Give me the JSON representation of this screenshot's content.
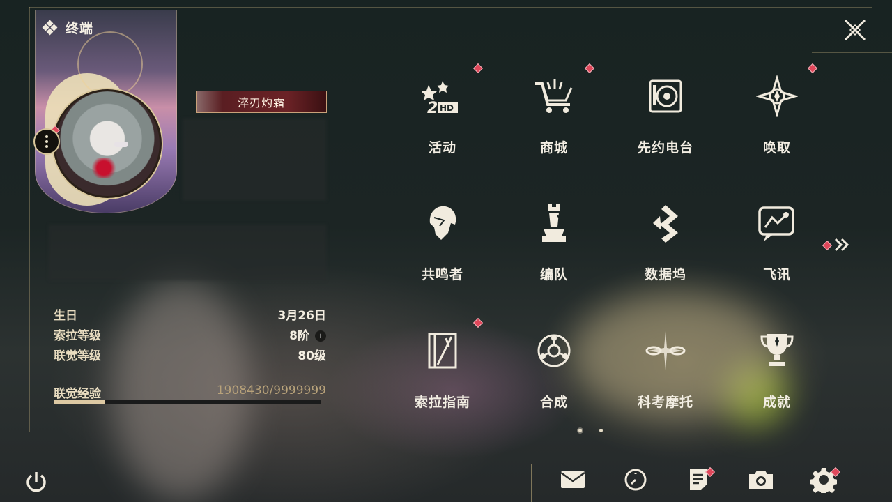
{
  "header": {
    "title": "终端"
  },
  "profile": {
    "name": "淬刃灼霜",
    "stats": [
      {
        "label": "生日",
        "value": "3月26日"
      },
      {
        "label": "索拉等级",
        "value": "8阶",
        "has_info": true
      },
      {
        "label": "联觉等级",
        "value": "80级"
      }
    ],
    "experience": {
      "label": "联觉经验",
      "value": "1908430/9999999",
      "progress": 0.19
    }
  },
  "menu": {
    "items": [
      {
        "label": "活动",
        "icon": "event-2hd-icon",
        "badge": true
      },
      {
        "label": "商城",
        "icon": "shop-cart-icon",
        "badge": true
      },
      {
        "label": "先约电台",
        "icon": "radio-icon",
        "badge": false
      },
      {
        "label": "唤取",
        "icon": "compass-star-icon",
        "badge": true
      },
      {
        "label": "共鸣者",
        "icon": "resonator-head-icon",
        "badge": false
      },
      {
        "label": "编队",
        "icon": "team-chess-icon",
        "badge": false
      },
      {
        "label": "数据坞",
        "icon": "data-bank-icon",
        "badge": false
      },
      {
        "label": "飞讯",
        "icon": "message-chat-icon",
        "badge": false
      },
      {
        "label": "索拉指南",
        "icon": "guide-book-icon",
        "badge": true
      },
      {
        "label": "合成",
        "icon": "synthesis-orb-icon",
        "badge": false
      },
      {
        "label": "科考摩托",
        "icon": "motorbike-icon",
        "badge": false
      },
      {
        "label": "成就",
        "icon": "trophy-icon",
        "badge": false
      }
    ],
    "page": 1,
    "page_count": 2
  },
  "bottom_bar": [
    {
      "name": "mail-icon",
      "badge": false
    },
    {
      "name": "clock-icon",
      "badge": false
    },
    {
      "name": "notice-icon",
      "badge": true
    },
    {
      "name": "camera-icon",
      "badge": false
    },
    {
      "name": "settings-gear-icon",
      "badge": true
    }
  ],
  "colors": {
    "accent": "#d9c79b",
    "badge": "#e0475a",
    "text": "#f3eee3",
    "muted": "#b8a27a"
  }
}
